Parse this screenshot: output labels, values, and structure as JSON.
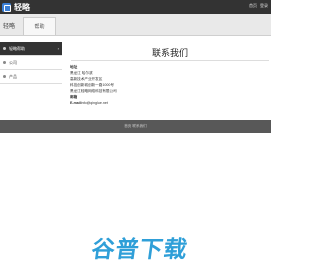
{
  "header": {
    "logo_text": "轻略",
    "links": [
      "首页",
      "登录"
    ]
  },
  "tabbar": {
    "title": "轻略",
    "tab_label": "帮助"
  },
  "sidebar": {
    "items": [
      {
        "label": "轻略帮助",
        "arrow": "›"
      },
      {
        "label": "公司"
      },
      {
        "label": "产品"
      }
    ]
  },
  "content": {
    "title": "联系我们",
    "lines": [
      {
        "text": "地址",
        "bold": true
      },
      {
        "text": "黑龙江 哈尔滨",
        "bold": false
      },
      {
        "text": "高新技术产业开发区",
        "bold": false
      },
      {
        "text": "科技创新城创新一路1000号",
        "bold": false
      },
      {
        "text": "黑龙江轻略网络科技有限公司",
        "bold": false
      },
      {
        "text": "邮箱",
        "bold": true
      }
    ],
    "email_label": "E-mail",
    "email_value": "info@qinglue.net"
  },
  "footer": {
    "text": "首页 联系我们"
  },
  "watermark": {
    "text": "谷普下载"
  }
}
